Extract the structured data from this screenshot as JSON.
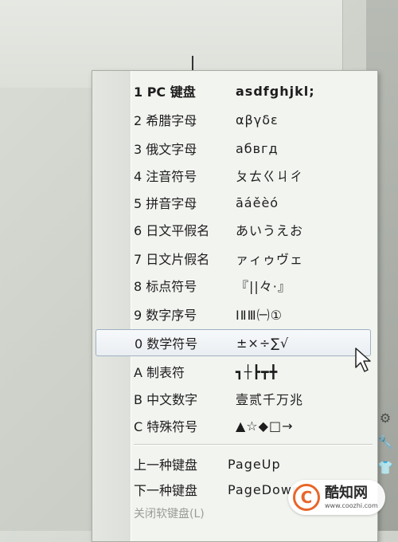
{
  "menu": {
    "items": [
      {
        "label": "1 PC 键盘",
        "sample": "asdfghjkl;"
      },
      {
        "label": "2 希腊字母",
        "sample": "αβγδε"
      },
      {
        "label": "3 俄文字母",
        "sample": "абвгд"
      },
      {
        "label": "4 注音符号",
        "sample": "ㄆㄊㄍㄐㄔ"
      },
      {
        "label": "5 拼音字母",
        "sample": "āáěèó"
      },
      {
        "label": "6 日文平假名",
        "sample": "あいうえお"
      },
      {
        "label": "7 日文片假名",
        "sample": "ァィゥヴェ"
      },
      {
        "label": "8 标点符号",
        "sample": "『||々·』"
      },
      {
        "label": "9 数字序号",
        "sample": "ⅠⅡⅢ㈠①"
      },
      {
        "label": "0 数学符号",
        "sample": "±×÷∑√"
      },
      {
        "label": "A 制表符",
        "sample": "┓┼┣┳╋"
      },
      {
        "label": "B 中文数字",
        "sample": "壹贰千万兆"
      },
      {
        "label": "C 特殊符号",
        "sample": "▲☆◆□→"
      }
    ],
    "prev_keyboard": {
      "label": "上一种键盘",
      "shortcut": "PageUp"
    },
    "next_keyboard": {
      "label": "下一种键盘",
      "shortcut": "PageDown"
    },
    "close": {
      "label": "关闭软键盘(L)"
    }
  },
  "side_icons": [
    "gear-icon",
    "wrench-icon",
    "shirt-icon"
  ],
  "watermark": {
    "logo": "C",
    "name": "酷知网",
    "url": "www.coozhi.com"
  }
}
